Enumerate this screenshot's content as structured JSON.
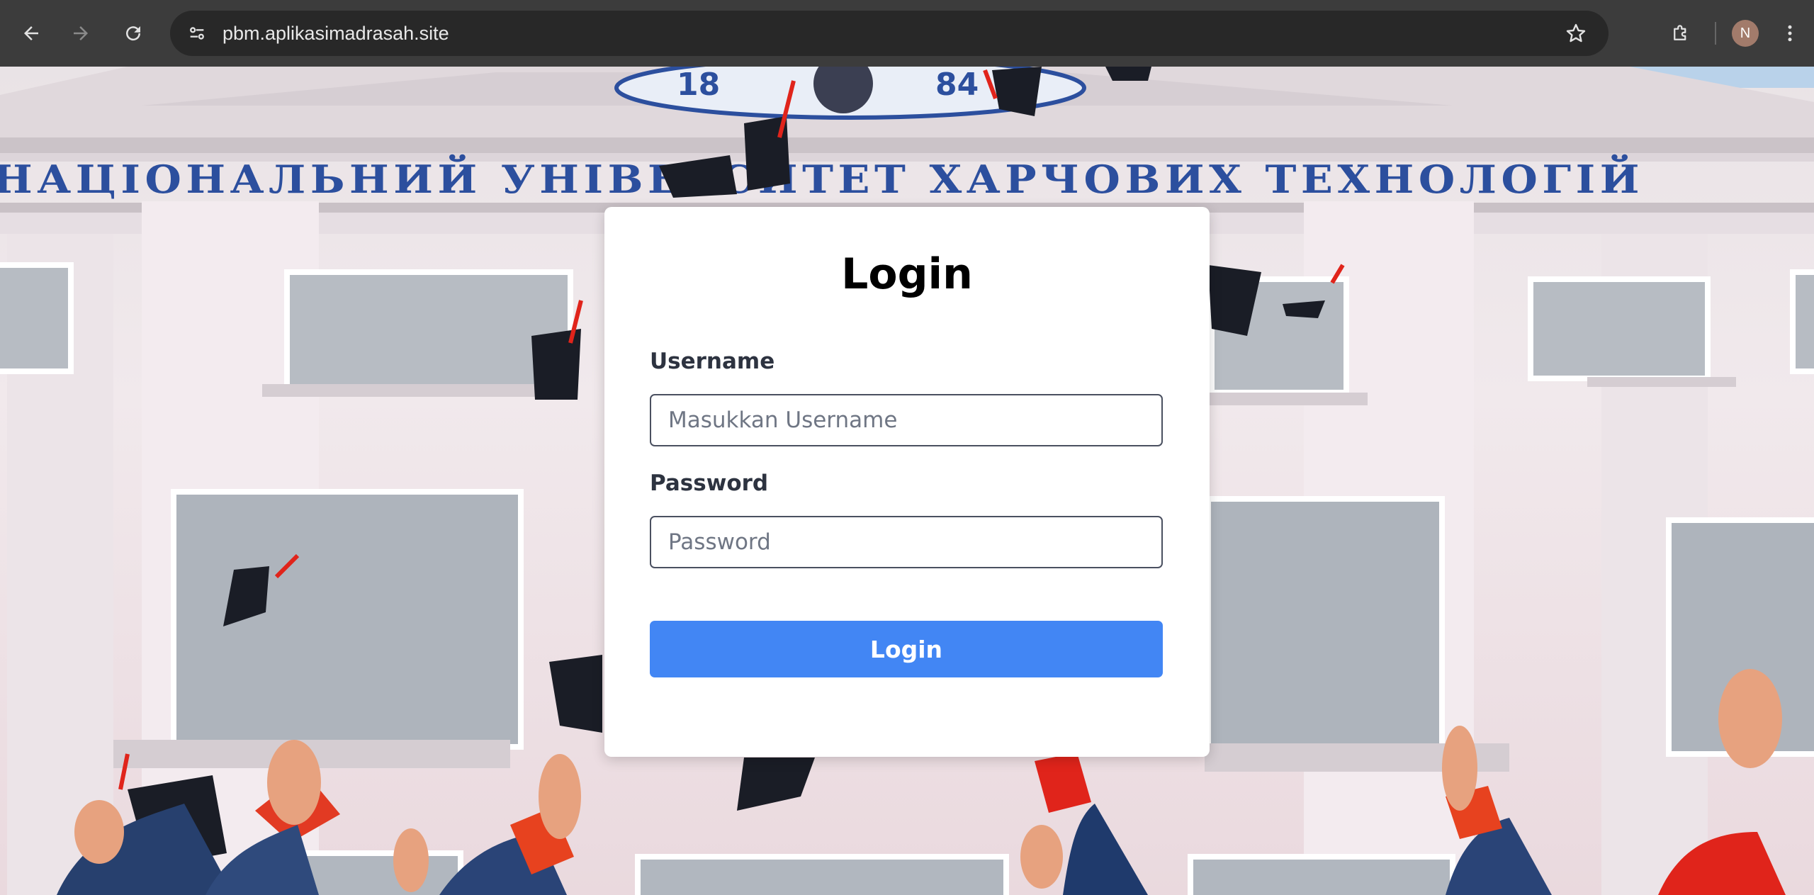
{
  "browser": {
    "url": "pbm.aplikasimadrasah.site",
    "profile_initial": "N",
    "icons": {
      "back": "arrow-left-icon",
      "forward": "arrow-right-icon",
      "reload": "reload-icon",
      "site_info": "tune-icon",
      "bookmark": "star-icon",
      "extensions": "puzzle-icon",
      "menu": "kebab-menu-icon"
    }
  },
  "background": {
    "building_sign": "НАЦІОНАЛЬНИЙ УНІВЕРСИТЕТ ХАРЧОВИХ ТЕХНОЛОГІЙ",
    "year_left": "18",
    "year_right": "84"
  },
  "login": {
    "title": "Login",
    "username_label": "Username",
    "username_placeholder": "Masukkan Username",
    "username_value": "",
    "password_label": "Password",
    "password_placeholder": "Password",
    "password_value": "",
    "submit_label": "Login"
  },
  "colors": {
    "chrome_bg": "#3c3c3c",
    "address_bar_bg": "#282828",
    "button_primary": "#4286f4",
    "card_bg": "#ffffff",
    "sign_blue": "#2c4f9e"
  }
}
